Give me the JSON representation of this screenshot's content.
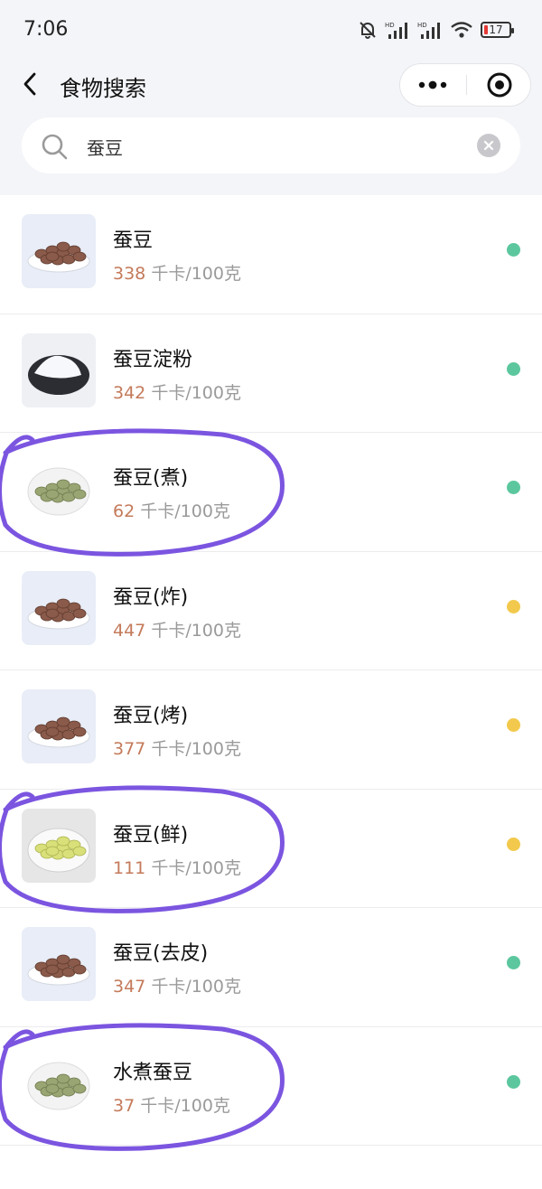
{
  "status": {
    "time": "7:06",
    "battery": "17"
  },
  "nav": {
    "title": "食物搜索"
  },
  "search": {
    "value": "蚕豆",
    "placeholder": ""
  },
  "unit_suffix": "千卡/100克",
  "foods": [
    {
      "name": "蚕豆",
      "kcal": "338",
      "unit": "千卡/100克",
      "level": "green",
      "image": "brown-beans",
      "highlighted": false
    },
    {
      "name": "蚕豆淀粉",
      "kcal": "342",
      "unit": "千卡/100克",
      "level": "green",
      "image": "starch-powder",
      "highlighted": false
    },
    {
      "name": "蚕豆(煮)",
      "kcal": "62",
      "unit": "千卡/100克",
      "level": "green",
      "image": "boiled-beans",
      "highlighted": true
    },
    {
      "name": "蚕豆(炸)",
      "kcal": "447",
      "unit": "千卡/100克",
      "level": "yellow",
      "image": "brown-beans",
      "highlighted": false
    },
    {
      "name": "蚕豆(烤)",
      "kcal": "377",
      "unit": "千卡/100克",
      "level": "yellow",
      "image": "brown-beans",
      "highlighted": false
    },
    {
      "name": "蚕豆(鲜)",
      "kcal": "111",
      "unit": "千卡/100克",
      "level": "yellow",
      "image": "fresh-beans",
      "highlighted": true
    },
    {
      "name": "蚕豆(去皮)",
      "kcal": "347",
      "unit": "千卡/100克",
      "level": "green",
      "image": "brown-beans",
      "highlighted": false
    },
    {
      "name": "水煮蚕豆",
      "kcal": "37",
      "unit": "千卡/100克",
      "level": "green",
      "image": "boiled-beans",
      "highlighted": true
    }
  ],
  "colors": {
    "green": "#5cc79e",
    "yellow": "#f2c94c",
    "kcal_number": "#c47a5a",
    "highlight_stroke": "#7b55e0"
  }
}
